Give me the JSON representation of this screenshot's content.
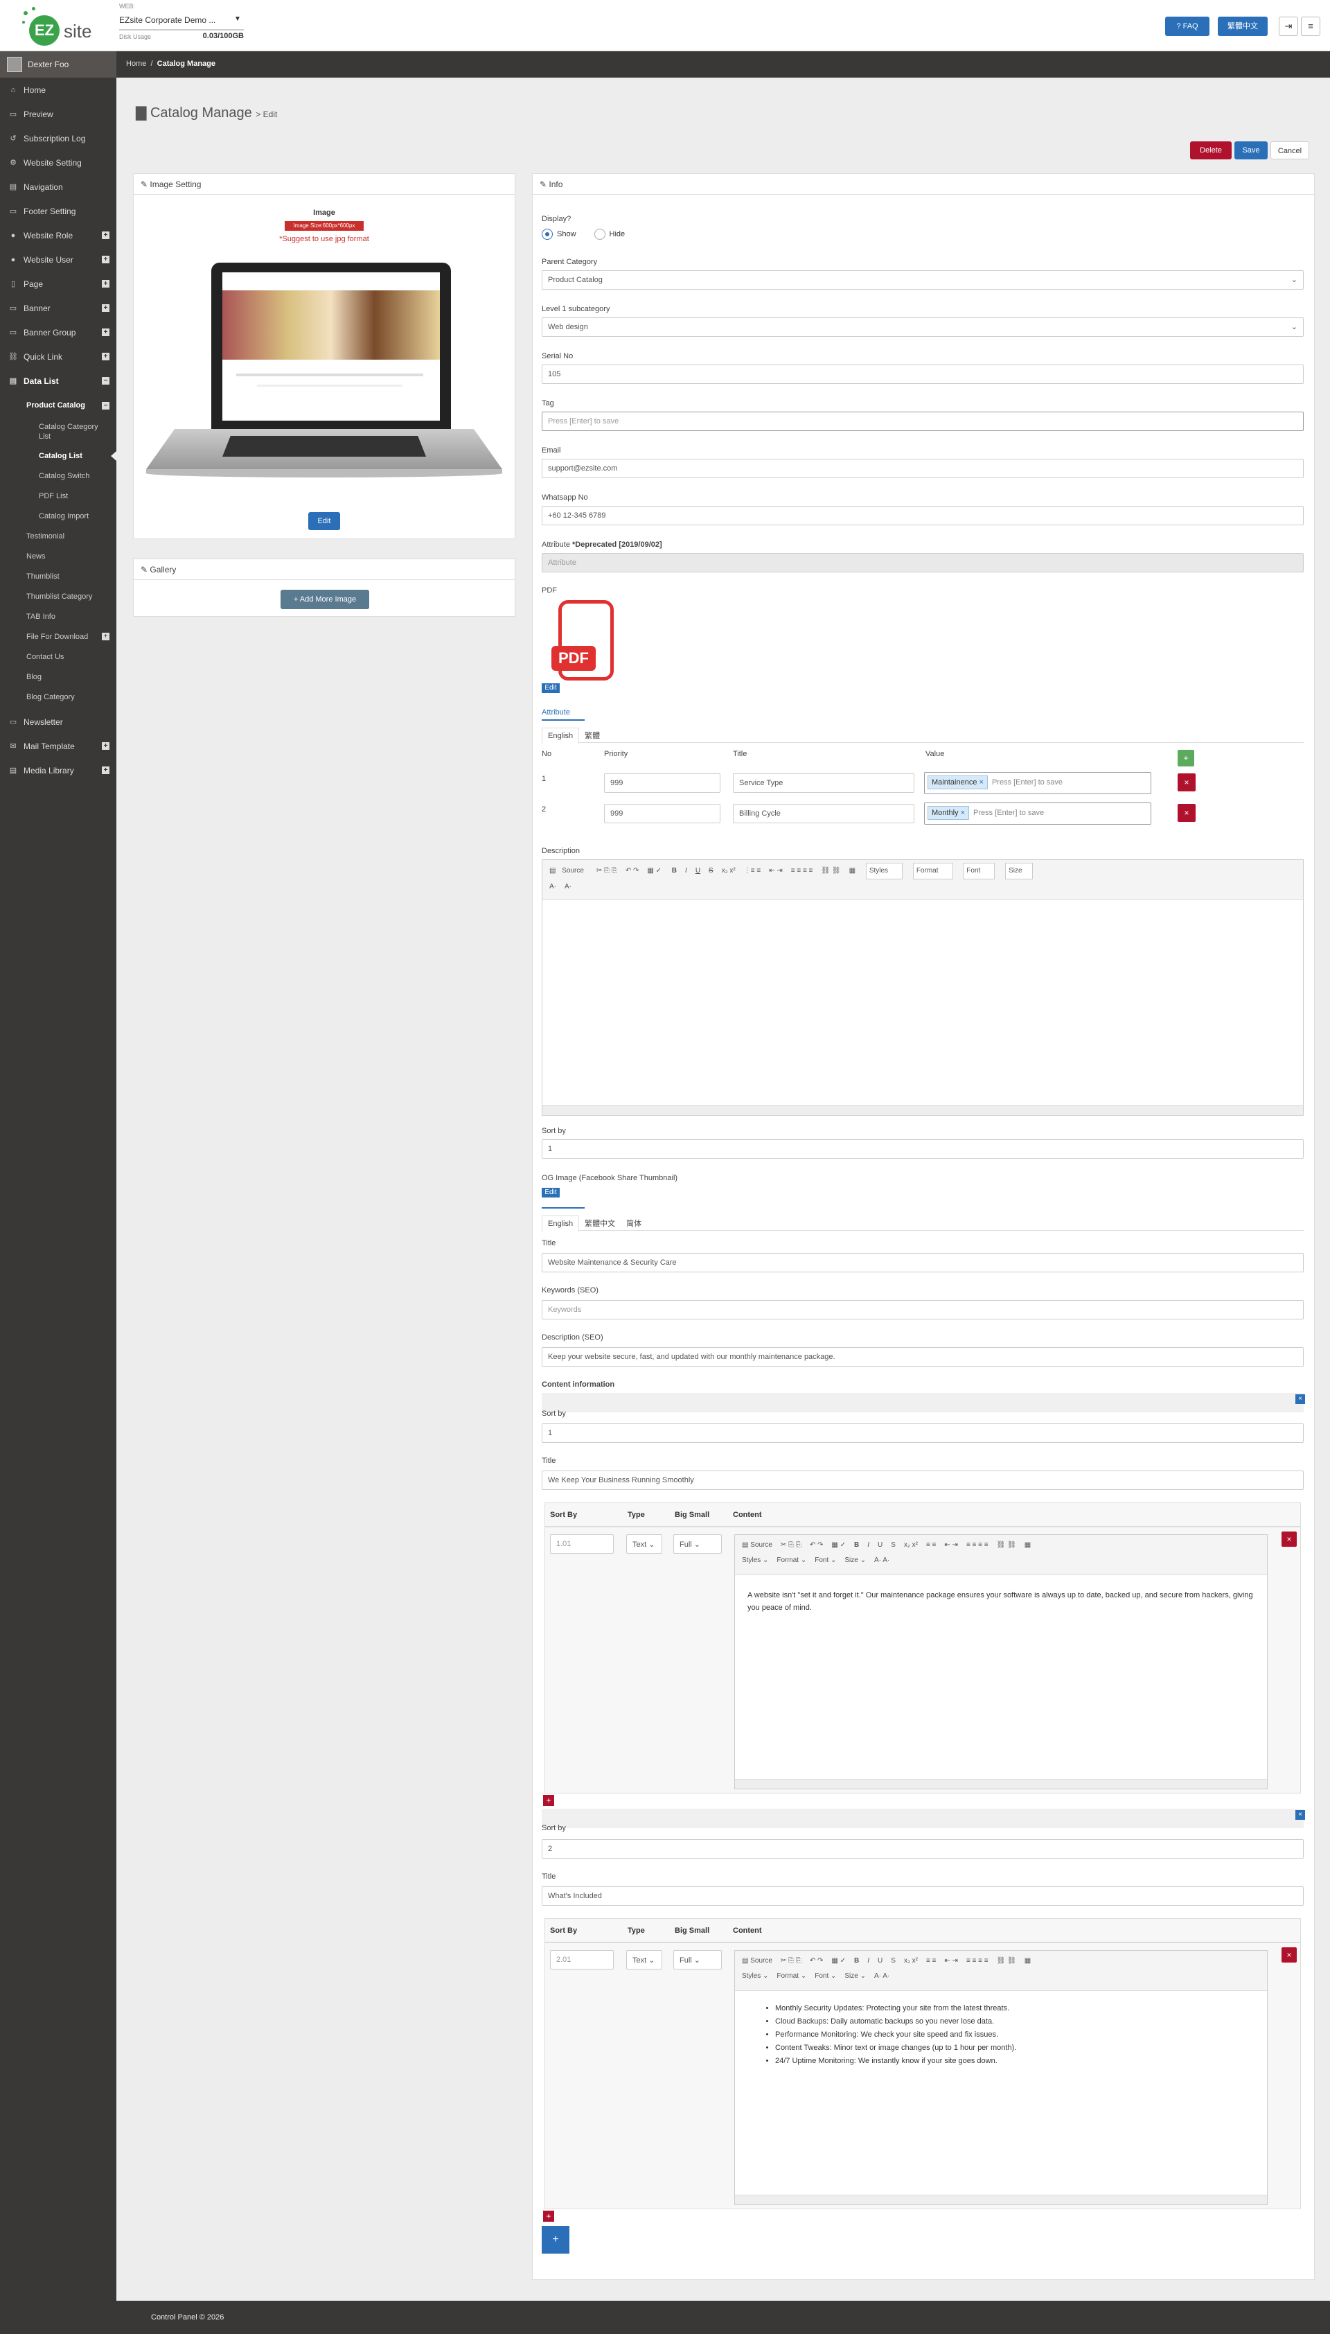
{
  "header": {
    "web_label": "WEB:",
    "site_name": "EZsite Corporate Demo ...",
    "disk_label": "Disk Usage",
    "disk_value": "0.03/100GB",
    "faq": "? FAQ",
    "lang": "繁體中文",
    "logo_text": "site"
  },
  "user": {
    "name": "Dexter Foo"
  },
  "nav": [
    {
      "label": "Home",
      "icon": "⌂"
    },
    {
      "label": "Preview",
      "icon": "▭"
    },
    {
      "label": "Subscription Log",
      "icon": "↺"
    },
    {
      "label": "Website Setting",
      "icon": "⚙"
    },
    {
      "label": "Navigation",
      "icon": "▤"
    },
    {
      "label": "Footer Setting",
      "icon": "▭"
    },
    {
      "label": "Website Role",
      "icon": "●"
    },
    {
      "label": "Website User",
      "icon": "●"
    },
    {
      "label": "Page",
      "icon": "▯"
    },
    {
      "label": "Banner",
      "icon": "▭"
    },
    {
      "label": "Banner Group",
      "icon": "▭"
    },
    {
      "label": "Quick Link",
      "icon": "⛓"
    },
    {
      "label": "Data List",
      "icon": "▤"
    }
  ],
  "sub": {
    "product_catalog": "Product Catalog",
    "catalog_category_list": "Catalog Category List",
    "catalog_list": "Catalog List",
    "catalog_switch": "Catalog Switch",
    "pdf_list": "PDF List",
    "catalog_import": "Catalog Import",
    "testimonial": "Testimonial",
    "news": "News",
    "thumblist": "Thumblist",
    "thumblist_category": "Thumblist Category",
    "tab_info": "TAB Info",
    "file_for_download": "File For Download",
    "contact_us": "Contact Us",
    "blog": "Blog",
    "blog_category": "Blog Category"
  },
  "nav2": [
    {
      "label": "Newsletter",
      "icon": "▭"
    },
    {
      "label": "Mail Template",
      "icon": "✉"
    },
    {
      "label": "Media Library",
      "icon": "▤"
    }
  ],
  "crumb": {
    "home": "Home",
    "sep": "/",
    "current": "Catalog Manage"
  },
  "page": {
    "title": "Catalog Manage",
    "subtitle": "> Edit",
    "delete": "Delete",
    "save": "Save",
    "cancel": "Cancel"
  },
  "image_panel": {
    "title": "Image Setting",
    "image_label": "Image",
    "size_badge": "Image Size:600px*600px",
    "suggest": "*Suggest to use jpg format",
    "edit": "Edit"
  },
  "gallery": {
    "title": "Gallery",
    "add": "+ Add More Image"
  },
  "info": {
    "title": "Info",
    "display_label": "Display?",
    "show": "Show",
    "hide": "Hide",
    "parent_category_label": "Parent Category",
    "parent_category": "Product Catalog",
    "level1_label": "Level 1 subcategory",
    "level1": "Web design",
    "serial_label": "Serial No",
    "serial": "105",
    "tag_label": "Tag",
    "tag_placeholder": "Press [Enter] to save",
    "email_label": "Email",
    "email": "support@ezsite.com",
    "whatsapp_label": "Whatsapp No",
    "whatsapp": "+60 12-345 6789",
    "attr_label": "Attribute",
    "attr_dep": "*Deprecated [2019/09/02]",
    "attr_placeholder": "Attribute",
    "pdf_label": "PDF",
    "pdf_icon_text": "PDF",
    "edit": "Edit"
  },
  "attribute": {
    "title": "Attribute",
    "tab_en": "English",
    "tab_zh": "繁體",
    "col_no": "No",
    "col_priority": "Priority",
    "col_title": "Title",
    "col_value": "Value",
    "add": "+",
    "rows": [
      {
        "no": "1",
        "priority": "999",
        "title": "Service Type",
        "tag": "Maintainence",
        "placeholder": "Press [Enter] to save"
      },
      {
        "no": "2",
        "priority": "999",
        "title": "Billing Cycle",
        "tag": "Monthly",
        "placeholder": "Press [Enter] to save"
      }
    ]
  },
  "description": {
    "label": "Description",
    "toolbar": [
      "Source",
      "Styles",
      "Format",
      "Font",
      "Size"
    ]
  },
  "sortby": {
    "label": "Sort by",
    "value": "1"
  },
  "og": {
    "label": "OG Image (Facebook Share Thumbnail)",
    "edit": "Edit"
  },
  "seo": {
    "tab_en": "English",
    "tab_zh": "繁體中文",
    "tab_cn": "简体",
    "title_label": "Title",
    "title": "Website Maintenance & Security Care",
    "kw_label": "Keywords (SEO)",
    "kw_placeholder": "Keywords",
    "desc_label": "Description (SEO)",
    "desc": "Keep your website secure, fast, and updated with our monthly maintenance package."
  },
  "content_info": {
    "label": "Content information",
    "blocks": [
      {
        "sort_label": "Sort by",
        "sort": "1",
        "title_label": "Title",
        "title": "We Keep Your Business Running Smoothly",
        "cols": [
          "Sort By",
          "Type",
          "Big Small",
          "Content"
        ],
        "row_sort": "1.01",
        "type": "Text",
        "size": "Full",
        "text": "A website isn't \"set it and forget it.\" Our maintenance package ensures your software is always up to date, backed up, and secure from hackers, giving you peace of mind.",
        "bullets": []
      },
      {
        "sort_label": "Sort by",
        "sort": "2",
        "title_label": "Title",
        "title": "What's Included",
        "cols": [
          "Sort By",
          "Type",
          "Big Small",
          "Content"
        ],
        "row_sort": "2.01",
        "type": "Text",
        "size": "Full",
        "text": "",
        "bullets": [
          "Monthly Security Updates: Protecting your site from the latest threats.",
          "Cloud Backups: Daily automatic backups so you never lose data.",
          "Performance Monitoring: We check your site speed and fix issues.",
          "Content Tweaks: Minor text or image changes (up to 1 hour per month).",
          "24/7 Uptime Monitoring: We instantly know if your site goes down."
        ]
      }
    ]
  },
  "footer": {
    "text": "Control Panel © 2026"
  },
  "colors": {
    "accent": "#2a6fb8",
    "danger": "#b0122e",
    "sidebar": "#3a3836"
  }
}
